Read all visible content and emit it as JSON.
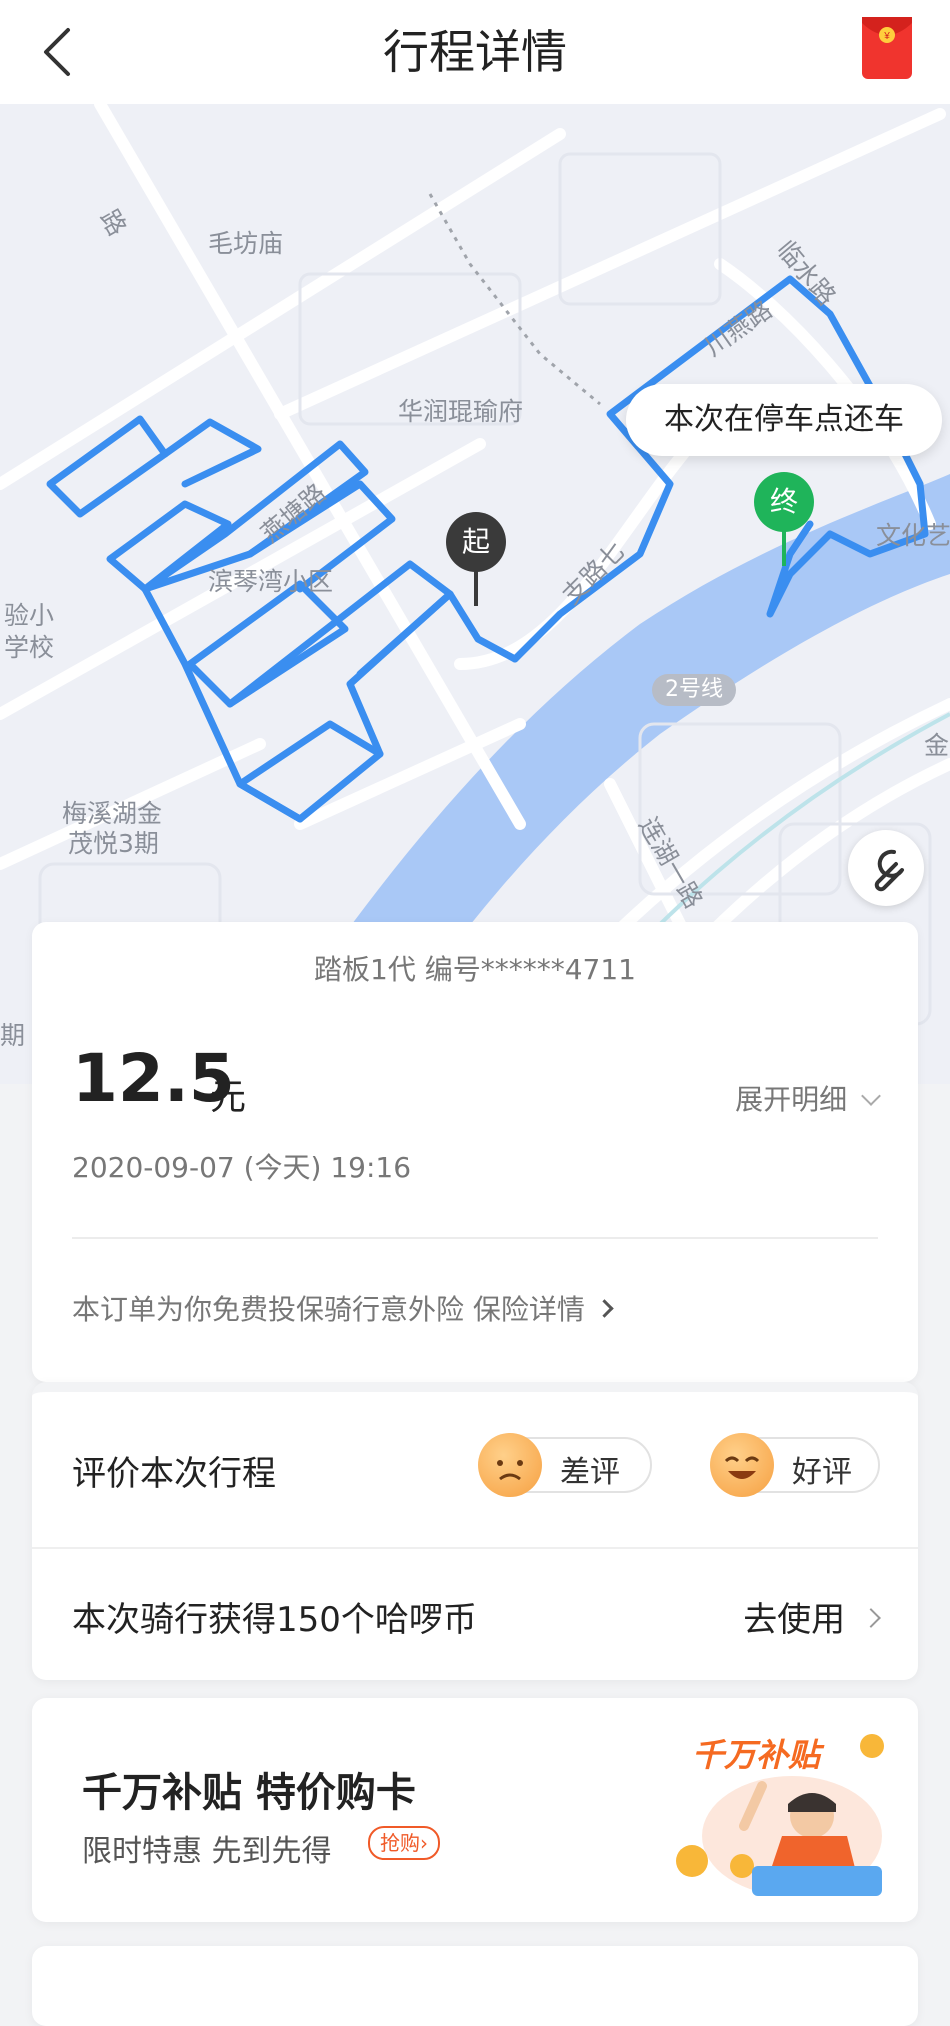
{
  "header": {
    "title": "行程详情"
  },
  "map": {
    "labels": {
      "road1": "路",
      "maofangmiao": "毛坊庙",
      "linshui": "临水路",
      "chuanyan": "川燕路",
      "huarun": "华润琨瑜府",
      "yantang": "燕塘路",
      "qinwan": "滨琴湾小区",
      "zhilu": "支路七",
      "wenhua": "文化艺",
      "yanxiao": "验小",
      "xuexiao": "学校",
      "meixi1": "梅溪湖金",
      "meixi2": "茂悦3期",
      "lianhu": "连湖一路",
      "jin": "金",
      "qi": "期"
    },
    "callout": "本次在停车点还车",
    "start_pin": "起",
    "end_pin": "终",
    "metro_line": "2号线",
    "route_color": "#3a8ef0"
  },
  "trip": {
    "vehicle": "踏板1代 编号******4711",
    "price": "12.5",
    "unit": "元",
    "expand": "展开明细",
    "time": "2020-09-07 (今天) 19:16",
    "insurance": "本订单为你免费投保骑行意外险 保险详情"
  },
  "rating": {
    "title": "评价本次行程",
    "bad": "差评",
    "good": "好评",
    "coins": "本次骑行获得150个哈啰币",
    "use": "去使用"
  },
  "promo": {
    "title": "千万补贴 特价购卡",
    "subtitle": "限时特惠 先到先得",
    "badge": "抢购",
    "art_title": "千万补贴"
  }
}
